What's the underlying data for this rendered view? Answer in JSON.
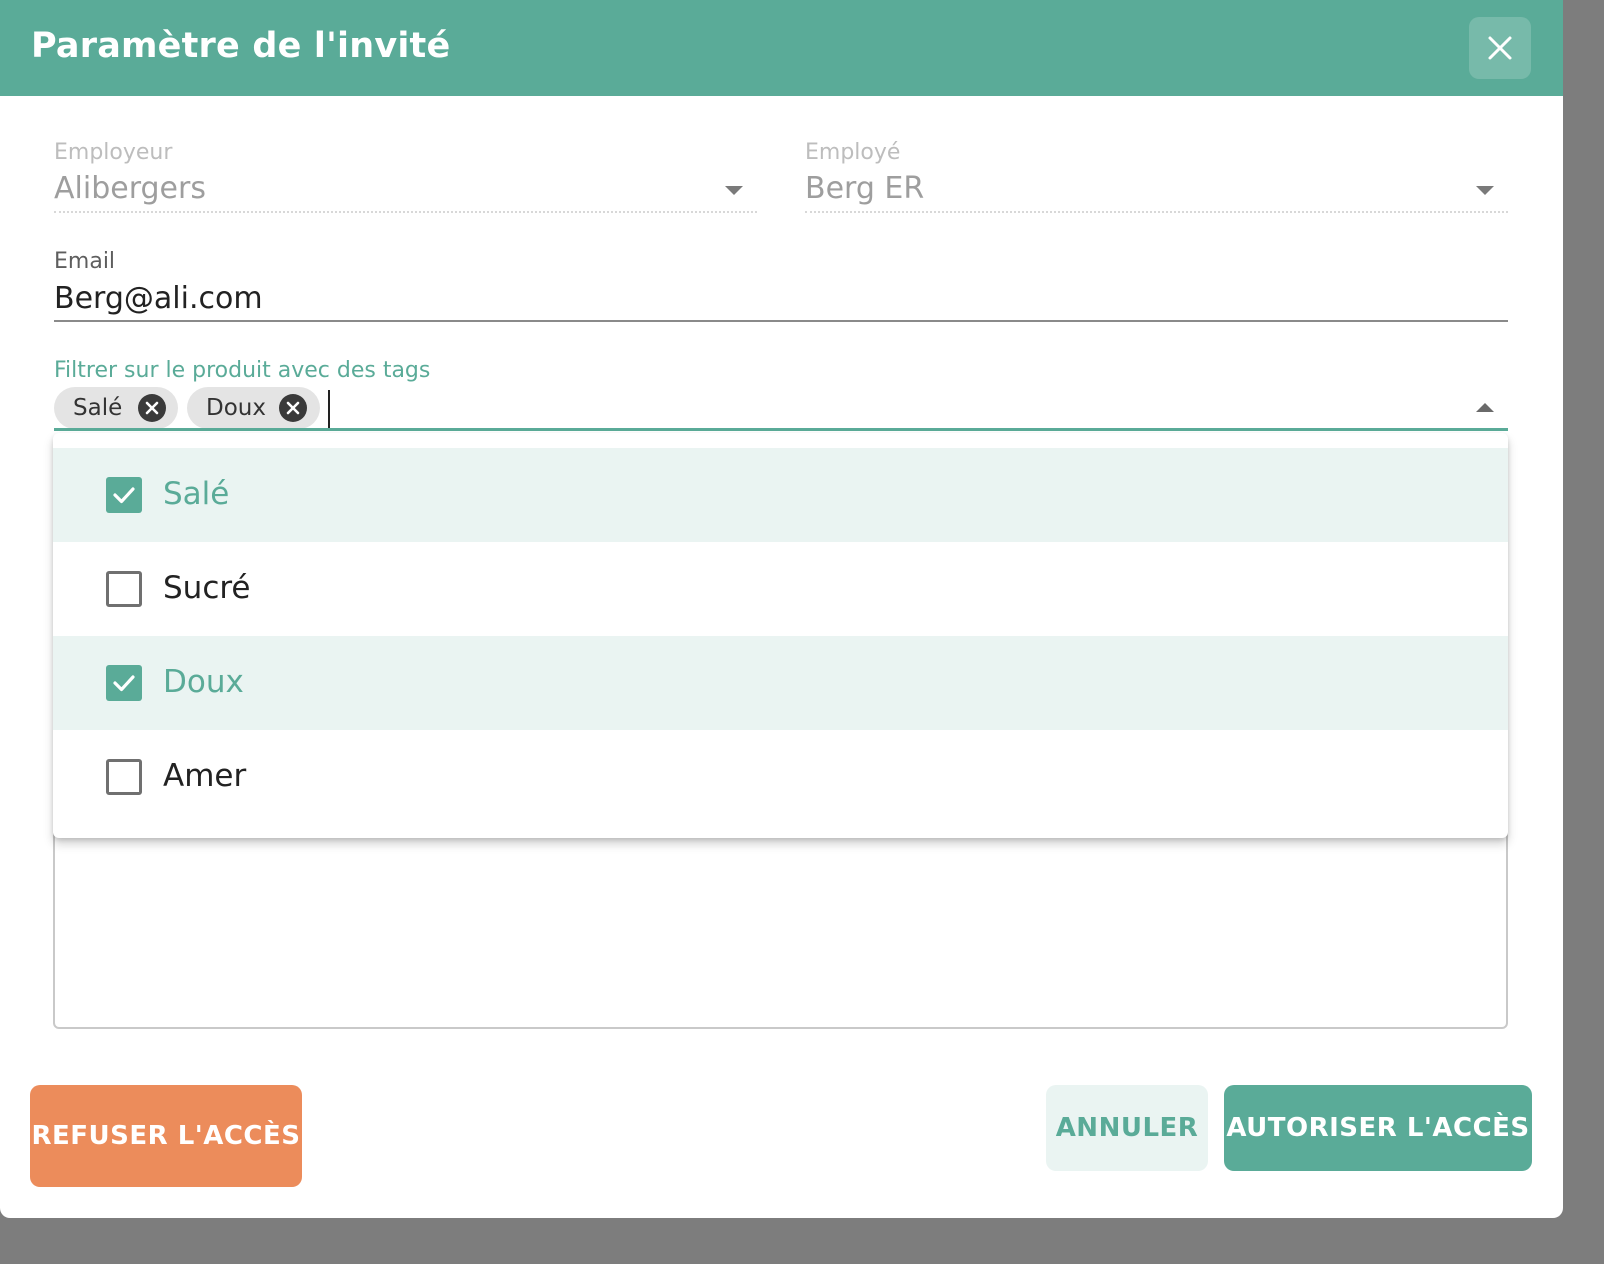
{
  "dialog": {
    "title": "Paramètre de l'invité",
    "close_icon": "close-icon"
  },
  "form": {
    "employer": {
      "label": "Employeur",
      "value": "Alibergers"
    },
    "employee": {
      "label": "Employé",
      "value": "Berg ER"
    },
    "email": {
      "label": "Email",
      "value": "Berg@ali.com"
    },
    "tags": {
      "label": "Filtrer sur le produit avec des tags",
      "chips": [
        {
          "label": "Salé"
        },
        {
          "label": "Doux"
        }
      ]
    }
  },
  "dropdown": {
    "options": [
      {
        "label": "Salé",
        "checked": true
      },
      {
        "label": "Sucré",
        "checked": false
      },
      {
        "label": "Doux",
        "checked": true
      },
      {
        "label": "Amer",
        "checked": false
      }
    ]
  },
  "actions": {
    "refuse_label": "REFUSER L'ACCÈS",
    "cancel_label": "ANNULER",
    "allow_label": "AUTORISER L'ACCÈS"
  },
  "colors": {
    "primary": "#5aab98",
    "danger": "#ec8c5b",
    "selected_bg": "#eaf4f2"
  }
}
